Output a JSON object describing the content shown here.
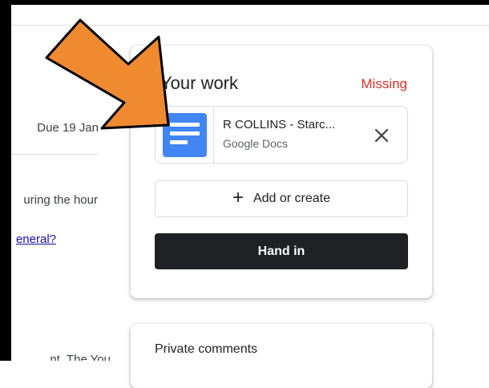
{
  "left_panel": {
    "due_date": "Due 19 Jan",
    "description_fragment": "uring the hour",
    "link_fragment": "eneral?",
    "bottom_fragment": "nt. The You"
  },
  "your_work": {
    "title": "Your work",
    "status": "Missing",
    "status_color": "#d93025",
    "attachment": {
      "name": "R COLLINS - Starc...",
      "type": "Google Docs",
      "icon": "google-docs-icon",
      "remove_icon": "close-icon"
    },
    "add_label": "Add or create",
    "add_icon": "plus-icon",
    "hand_in_label": "Hand in"
  },
  "private_comments": {
    "title": "Private comments"
  },
  "annotation": {
    "arrow_color": "#f08a31"
  }
}
